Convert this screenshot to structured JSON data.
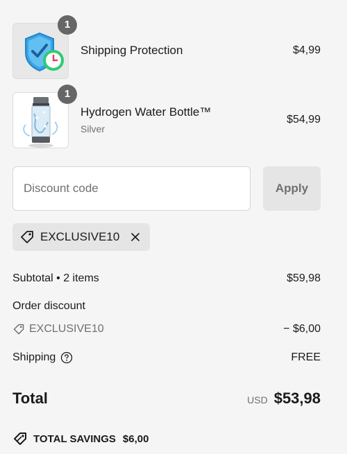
{
  "cart": {
    "items": [
      {
        "name": "Shipping Protection",
        "variant": "",
        "price": "$4,99",
        "quantity": "1",
        "image_icon": "shield-check-clock-icon"
      },
      {
        "name": "Hydrogen Water Bottle™",
        "variant": "Silver",
        "price": "$54,99",
        "quantity": "1",
        "image_icon": "water-bottle-image"
      }
    ]
  },
  "discount": {
    "placeholder": "Discount code",
    "value": "",
    "apply_label": "Apply",
    "applied_code": "EXCLUSIVE10"
  },
  "summary": {
    "subtotal_label": "Subtotal • 2 items",
    "subtotal_value": "$59,98",
    "order_discount_label": "Order discount",
    "discount_code": "EXCLUSIVE10",
    "discount_value": "− $6,00",
    "shipping_label": "Shipping",
    "shipping_value": "FREE",
    "total_label": "Total",
    "currency": "USD",
    "total_value": "$53,98"
  },
  "savings": {
    "label": "TOTAL SAVINGS",
    "value": "$6,00"
  },
  "colors": {
    "background": "#f5f5f5",
    "badge": "#666666",
    "shield_blue": "#3aa3e3",
    "clock_green": "#2ecc71"
  }
}
